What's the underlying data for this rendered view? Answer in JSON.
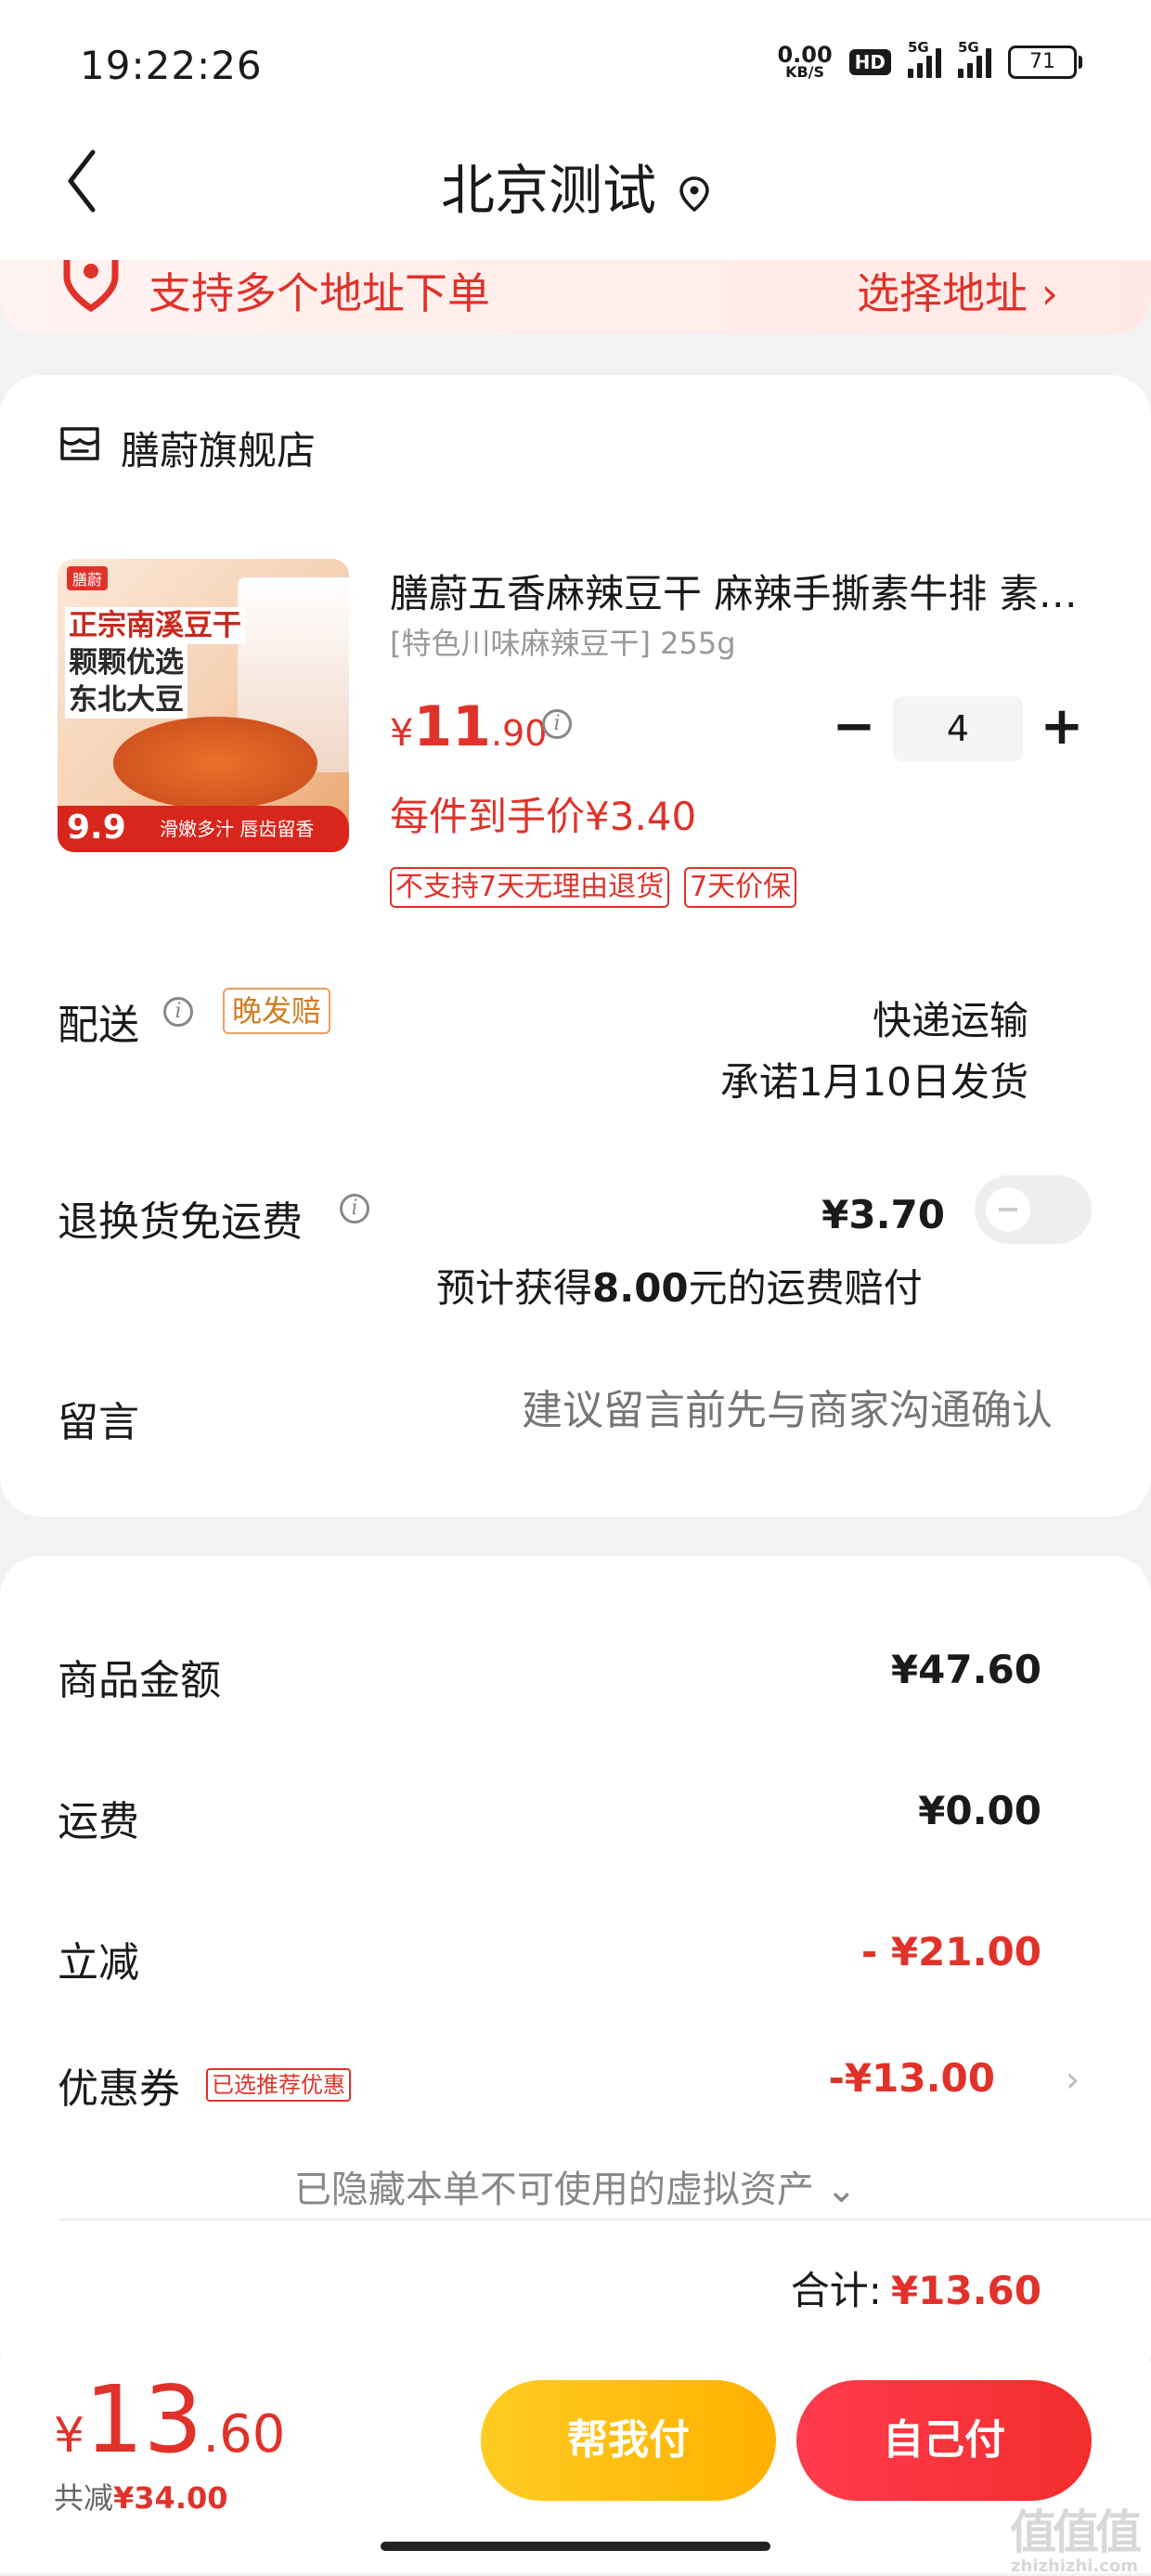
{
  "status_bar": {
    "time": "19:22:26",
    "net_speed": "0.00",
    "net_unit": "KB/S",
    "hd": "HD",
    "signal_label_1": "5G",
    "signal_label_2": "5G",
    "battery": "71"
  },
  "header": {
    "title": "北京测试"
  },
  "address_banner": {
    "text": "支持多个地址下单",
    "action": "选择地址 ›"
  },
  "store": {
    "name": "膳蔚旗舰店"
  },
  "product": {
    "image_badge": "膳蔚",
    "image_headline_1": "正宗南溪豆干",
    "image_headline_2": "颗颗优选",
    "image_headline_3": "东北大豆",
    "image_price": "9.9",
    "image_slogan": "滑嫩多汁 唇齿留香",
    "name": "膳蔚五香麻辣豆干 麻辣手撕素牛排 素肉 零食",
    "spec": "[特色川味麻辣豆干] 255g",
    "price_currency": "¥",
    "price_int": "11",
    "price_dec": ".90",
    "quantity": "4",
    "unit_price": "每件到手价¥3.40",
    "tags": [
      "不支持7天无理由退货",
      "7天价保"
    ]
  },
  "shipping": {
    "label": "配送",
    "late_tag": "晚发赔",
    "method": "快递运输",
    "date": "承诺1月10日发货"
  },
  "return_shipping": {
    "label": "退换货免运费",
    "price": "¥3.70",
    "note_prefix": "预计获得",
    "note_amount": "8.00",
    "note_suffix": "元的运费赔付",
    "enabled": false
  },
  "message": {
    "label": "留言",
    "placeholder": "建议留言前先与商家沟通确认"
  },
  "summary": {
    "goods_label": "商品金额",
    "goods_value": "¥47.60",
    "freight_label": "运费",
    "freight_value": "¥0.00",
    "discount_label": "立减",
    "discount_value": "- ¥21.00",
    "coupon_label": "优惠券",
    "coupon_tag": "已选推荐优惠",
    "coupon_value": "-¥13.00",
    "hidden_assets": "已隐藏本单不可使用的虚拟资产 ⌄",
    "total_label": "合计:",
    "total_value": "¥13.60"
  },
  "bottom": {
    "currency": "¥",
    "price_int": "13",
    "price_dec": ".60",
    "saved_label": "共减",
    "saved_value": "¥34.00",
    "help_pay": "帮我付",
    "self_pay": "自己付"
  },
  "watermark": {
    "text": "值值值",
    "sub": "zhizhizhi.com"
  },
  "colors": {
    "accent": "#e0322a",
    "help_button": "#ffc21a",
    "self_button": "#f22d2d"
  }
}
